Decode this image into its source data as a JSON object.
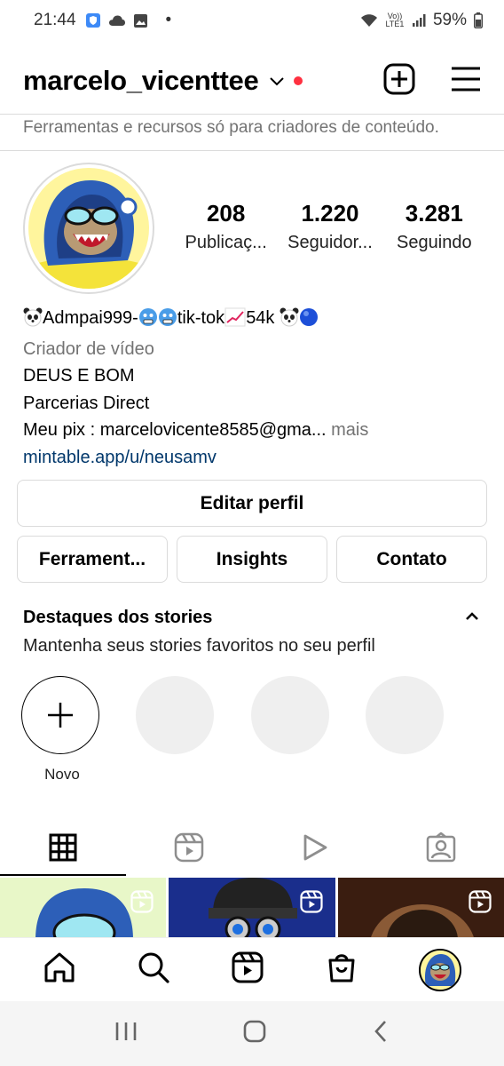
{
  "status_bar": {
    "time": "21:44",
    "dot": "•",
    "network_label": "Vo)) LTE1",
    "battery": "59%"
  },
  "header": {
    "username": "marcelo_vicenttee"
  },
  "creator_banner": "Ferramentas e recursos só para criadores de conteúdo.",
  "stats": [
    {
      "value": "208",
      "label": "Publicaç..."
    },
    {
      "value": "1.220",
      "label": "Seguidor..."
    },
    {
      "value": "3.281",
      "label": "Seguindo"
    }
  ],
  "bio": {
    "name_part1": "Admpai999-",
    "name_part2": "tik-tok",
    "name_part3": "54k",
    "category": "Criador de vídeo",
    "line1": "DEUS E BOM",
    "line2": "Parcerias Direct",
    "line3": "Meu pix : marcelovicente8585@gma...",
    "more": "mais",
    "link": "mintable.app/u/neusamv"
  },
  "buttons": {
    "edit_profile": "Editar perfil",
    "tools": "Ferrament...",
    "insights": "Insights",
    "contact": "Contato"
  },
  "highlights": {
    "title": "Destaques dos stories",
    "subtitle": "Mantenha seus stories favoritos no seu perfil",
    "new_label": "Novo"
  },
  "colors": {
    "link": "#00376b",
    "notification_dot": "#ff3040",
    "muted_text": "#737373",
    "border": "#dbdbdb"
  }
}
